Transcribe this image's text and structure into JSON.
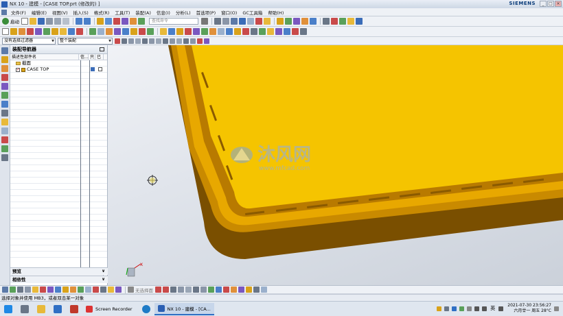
{
  "window": {
    "title": "NX 10 - 建模 - [CASE TOP.prt  (修改的)  ]",
    "brand": "SIEMENS",
    "controls": [
      "_",
      "□",
      "×"
    ]
  },
  "menubar": {
    "items": [
      "文件(F)",
      "编辑(E)",
      "视图(V)",
      "插入(S)",
      "格式(R)",
      "工具(T)",
      "装配(A)",
      "信息(I)",
      "分析(L)",
      "首选项(P)",
      "窗口(O)",
      "GC工具箱",
      "帮助(H)"
    ]
  },
  "toolbar": {
    "start_label": "启动",
    "search_placeholder": "查找命令",
    "filter_value": "没有选择过滤器",
    "assembly_value": "整个装配"
  },
  "navigator": {
    "title": "装配导航器",
    "columns": [
      "描述性部件名",
      "信...",
      "只",
      "已"
    ],
    "rows": [
      {
        "label": "截面"
      },
      {
        "label": "CASE TOP"
      }
    ],
    "sections": [
      "预览",
      "相依性"
    ]
  },
  "viewport": {
    "watermark_brand": "沐风网",
    "watermark_url": "www.mfcad.com",
    "triad_x": "X",
    "model_color": "#f5c400",
    "model_side_color": "#8a5a00",
    "model_lip_color": "#c98a00"
  },
  "bottombar": {
    "label": "无选择面"
  },
  "status": {
    "cue": "选择对象并使用 MB3，或者双击某一对象"
  },
  "taskbar": {
    "apps": [
      {
        "label": "Screen Recorder",
        "active": false
      },
      {
        "label": "NX 10 - 建模 - [CA...",
        "active": true
      }
    ],
    "ime": "英",
    "date": "2021-07-30 23:56:27",
    "day": "六月廿一 周五 28°C"
  }
}
